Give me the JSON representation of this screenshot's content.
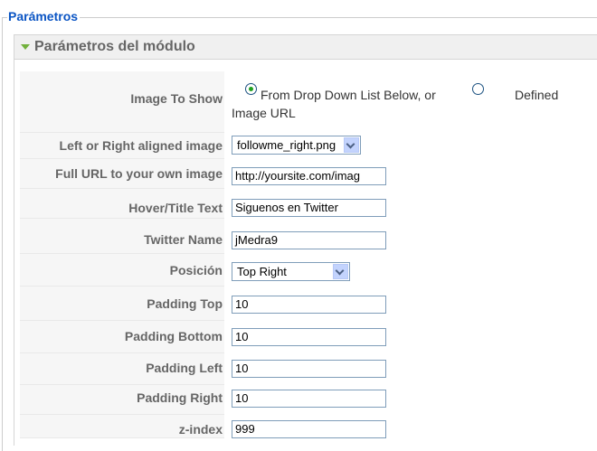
{
  "fieldset": {
    "legend": "Parámetros"
  },
  "panel": {
    "title": "Parámetros del módulo"
  },
  "rows": {
    "image_to_show": {
      "label": "Image To Show",
      "option1": "From Drop Down List Below, or",
      "option2_line1": "Defined",
      "option2_line2": "Image URL",
      "selected": "option1"
    },
    "aligned_image": {
      "label": "Left or Right aligned image",
      "value": "followme_right.png"
    },
    "full_url": {
      "label": "Full URL to your own image",
      "value": "http://yoursite.com/imag"
    },
    "hover_text": {
      "label": "Hover/Title Text",
      "value": "Siguenos en Twitter"
    },
    "twitter_name": {
      "label": "Twitter Name",
      "value": "jMedra9"
    },
    "posicion": {
      "label": "Posición",
      "value": "Top Right"
    },
    "padding_top": {
      "label": "Padding Top",
      "value": "10"
    },
    "padding_bottom": {
      "label": "Padding Bottom",
      "value": "10"
    },
    "padding_left": {
      "label": "Padding Left",
      "value": "10"
    },
    "padding_right": {
      "label": "Padding Right",
      "value": "10"
    },
    "z_index": {
      "label": "z-index",
      "value": "999"
    }
  },
  "colors": {
    "legend": "#0b55c4",
    "label": "#666666",
    "label_cell_bg": "#f6f6f6",
    "radio_checked": "#21a121"
  },
  "icons": {
    "panel_toggle": "triangle-down-icon",
    "select_toggle": "chevron-down-icon"
  }
}
